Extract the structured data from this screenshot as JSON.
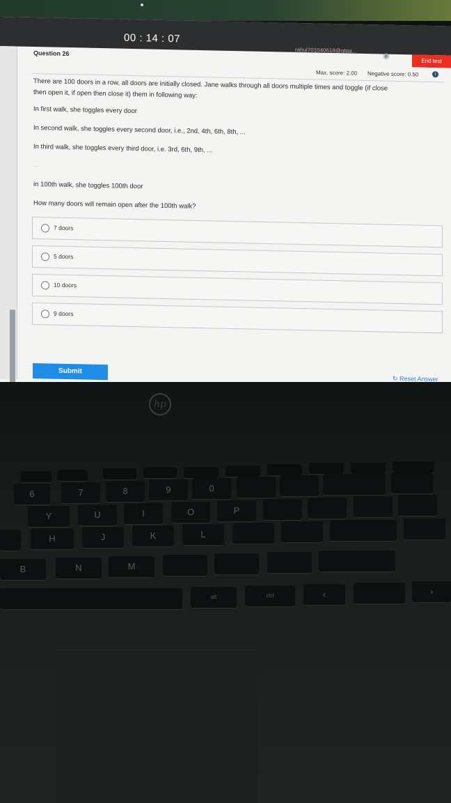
{
  "timer": "00 : 14 : 07",
  "header": {
    "user_id": "rahul701040618@gtga...",
    "end_test": "End test",
    "question_label": "Question  26",
    "max_score": "Max. score: 2.00",
    "negative_score": "Negative score: 0.50"
  },
  "question": {
    "line1": "There are 100 doors in a row, all doors are initially closed. Jane walks through all doors multiple times and toggle (if close",
    "line2": "then open it, if open then close it) them in following way:",
    "walk1": "In first walk, she toggles every door",
    "walk2": "In second walk, she toggles every second door, i.e., 2nd, 4th, 6th, 8th, ...",
    "walk3": "In third walk, she toggles every third door, i.e. 3rd, 6th, 9th, ...",
    "ellipsis": "...",
    "walk100": "in 100th walk, she toggles 100th door",
    "prompt": "How many doors will remain open after the 100th walk?"
  },
  "options": [
    "7 doors",
    "5 doors",
    "10 doors",
    "9 doors"
  ],
  "actions": {
    "submit": "Submit",
    "reset": "Reset Answer",
    "help": "?"
  },
  "laptop": {
    "logo": "hp",
    "keys_row1": [
      "6",
      "7",
      "8",
      "9",
      "0"
    ],
    "keys_row2": [
      "Y",
      "U",
      "I",
      "O",
      "P"
    ],
    "keys_row3": [
      "H",
      "J",
      "K",
      "L"
    ],
    "keys_row4": [
      "B",
      "N",
      "M"
    ],
    "alt": "alt",
    "ctrl": "ctrl"
  }
}
